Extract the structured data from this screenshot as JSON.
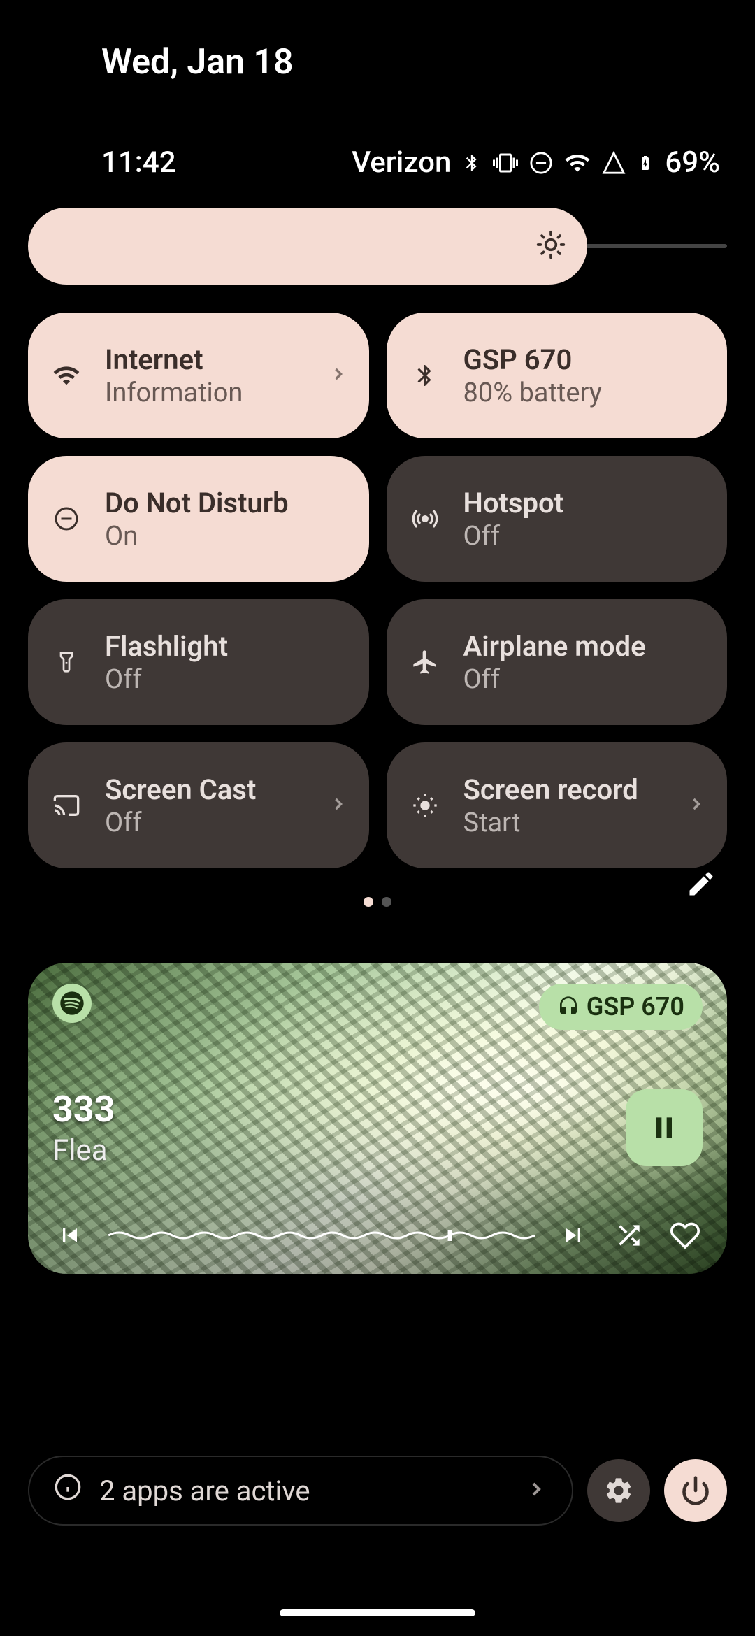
{
  "header": {
    "date": "Wed, Jan 18",
    "time": "11:42",
    "carrier": "Verizon",
    "battery": "69%"
  },
  "tiles": [
    {
      "title": "Internet",
      "sub": "Information",
      "active": true,
      "chevron": true,
      "icon": "wifi"
    },
    {
      "title": "GSP 670",
      "sub": "80% battery",
      "active": true,
      "chevron": false,
      "icon": "bluetooth"
    },
    {
      "title": "Do Not Disturb",
      "sub": "On",
      "active": true,
      "chevron": false,
      "icon": "dnd"
    },
    {
      "title": "Hotspot",
      "sub": "Off",
      "active": false,
      "chevron": false,
      "icon": "hotspot"
    },
    {
      "title": "Flashlight",
      "sub": "Off",
      "active": false,
      "chevron": false,
      "icon": "flashlight"
    },
    {
      "title": "Airplane mode",
      "sub": "Off",
      "active": false,
      "chevron": false,
      "icon": "airplane"
    },
    {
      "title": "Screen Cast",
      "sub": "Off",
      "active": false,
      "chevron": true,
      "icon": "cast"
    },
    {
      "title": "Screen record",
      "sub": "Start",
      "active": false,
      "chevron": true,
      "icon": "record"
    }
  ],
  "media": {
    "device": "GSP 670",
    "title": "333",
    "artist": "Flea",
    "playing": true
  },
  "footer": {
    "active_apps": "2 apps are active"
  }
}
